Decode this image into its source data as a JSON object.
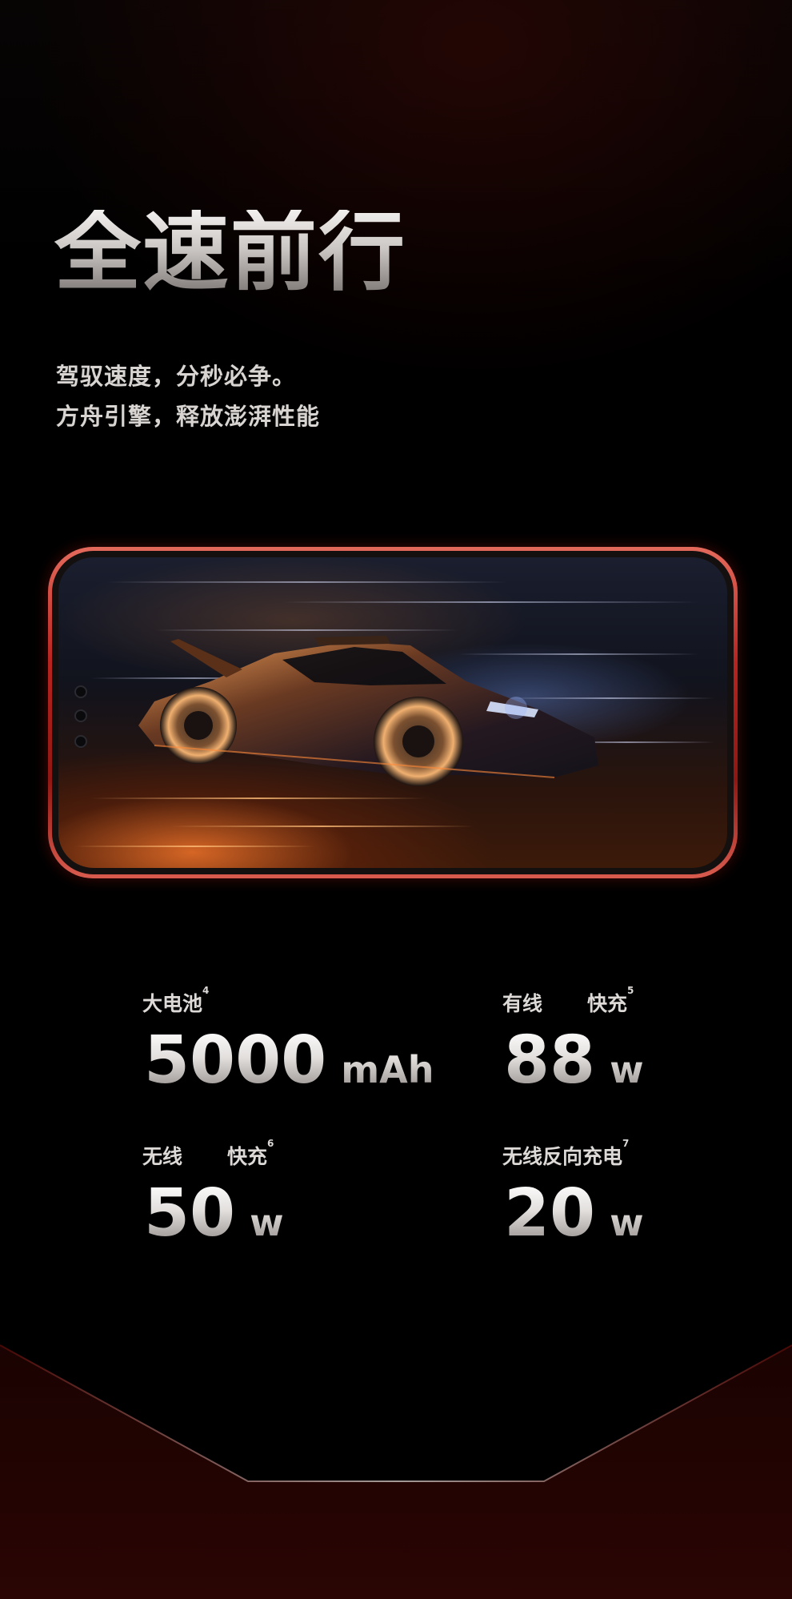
{
  "hero": {
    "title": "全速前行",
    "tagline_line1": "驾驭速度，分秒必争。",
    "tagline_line2": "方舟引擎，释放澎湃性能"
  },
  "specs": [
    {
      "label_a": "大电池",
      "label_b": "",
      "footnote": "4",
      "value": "5000",
      "unit": "mAh"
    },
    {
      "label_a": "有线",
      "label_b": "快充",
      "footnote": "5",
      "value": "88",
      "unit": "w"
    },
    {
      "label_a": "无线",
      "label_b": "快充",
      "footnote": "6",
      "value": "50",
      "unit": "w"
    },
    {
      "label_a": "无线反向充电",
      "label_b": "",
      "footnote": "7",
      "value": "20",
      "unit": "w"
    }
  ],
  "colors": {
    "background": "#000000",
    "phone_frame": "#b7241f",
    "accent_orange": "#e8742c"
  }
}
